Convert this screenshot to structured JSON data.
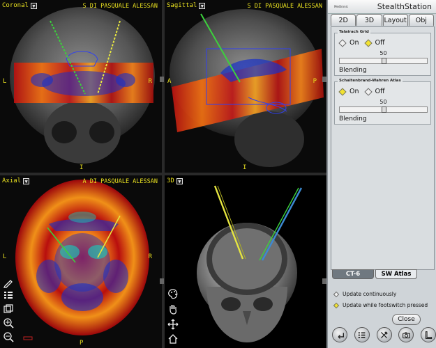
{
  "viewports": {
    "coronal": {
      "title": "Coronal",
      "patient": "S DI PASQUALE ALESSAN",
      "left": "L",
      "right": "R",
      "bottom": "I"
    },
    "sagittal": {
      "title": "Sagittal",
      "patient": "S DI PASQUALE ALESSAN",
      "left": "A",
      "right": "P",
      "bottom": "I"
    },
    "axial": {
      "title": "Axial",
      "patient": "A DI PASQUALE ALESSAN",
      "left": "L",
      "right": "R",
      "bottom": "P"
    },
    "threed": {
      "title": "3D"
    }
  },
  "panel": {
    "app_title": "StealthStation",
    "logo_text": "Medtronic",
    "tabs": [
      {
        "label": "2D",
        "active": false
      },
      {
        "label": "3D",
        "active": false
      },
      {
        "label": "Layout",
        "active": false
      },
      {
        "label": "Obj",
        "active": false
      }
    ],
    "talairach": {
      "title": "Talairach Grid",
      "on_label": "On",
      "off_label": "Off",
      "selected": "Off",
      "slider_value": "50",
      "slider_label": "Blending"
    },
    "schaltenbrand": {
      "title": "Schaltenbrand-Wahren Atlas",
      "on_label": "On",
      "off_label": "Off",
      "selected": "On",
      "slider_value": "50",
      "slider_label": "Blending"
    },
    "subtabs": [
      {
        "label": "CT-6"
      },
      {
        "label": "SW Atlas"
      }
    ],
    "update_continuously": "Update continuously",
    "update_footswitch": "Update while footswitch pressed",
    "update_selected": "footswitch",
    "close_label": "Close"
  },
  "colors": {
    "overlay_yellow": "#e8e020",
    "trajectory_green": "#3cd23c",
    "trajectory_yellow": "#e6e640",
    "panel_bg": "#cfd4d8"
  },
  "icons": {
    "left_tools_axial": [
      "pen-icon",
      "list-icon",
      "copy-icon",
      "zoom-in-icon",
      "zoom-out-icon"
    ],
    "left_tools_3d": [
      "palette-icon",
      "hand-icon",
      "move-icon",
      "home-icon"
    ],
    "bottom": [
      "back-arrow-icon",
      "checklist-icon",
      "tools-icon",
      "camera-icon",
      "footswitch-icon"
    ]
  }
}
